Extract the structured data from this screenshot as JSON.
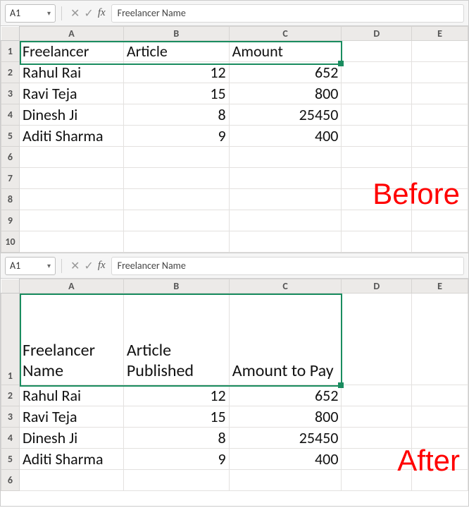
{
  "before": {
    "label": "Before",
    "name_box": "A1",
    "formula": "Freelancer Name",
    "columns": [
      "A",
      "B",
      "C",
      "D",
      "E"
    ],
    "rows": [
      "1",
      "2",
      "3",
      "4",
      "5",
      "6",
      "7",
      "8",
      "9",
      "10"
    ],
    "header": {
      "a": "Freelancer",
      "b": "Article",
      "c": "Amount"
    },
    "data": [
      {
        "name": "Rahul Rai",
        "articles": 12,
        "amount": 652
      },
      {
        "name": "Ravi Teja",
        "articles": 15,
        "amount": 800
      },
      {
        "name": "Dinesh Ji",
        "articles": 8,
        "amount": 25450
      },
      {
        "name": "Aditi Sharma",
        "articles": 9,
        "amount": 400
      }
    ]
  },
  "after": {
    "label": "After",
    "name_box": "A1",
    "formula": "Freelancer Name",
    "columns": [
      "A",
      "B",
      "C",
      "D",
      "E"
    ],
    "rows": [
      "1",
      "2",
      "3",
      "4",
      "5",
      "6"
    ],
    "header": {
      "a": "Freelancer Name",
      "b": "Article Published",
      "c": "Amount to Pay"
    },
    "data": [
      {
        "name": "Rahul Rai",
        "articles": 12,
        "amount": 652
      },
      {
        "name": "Ravi Teja",
        "articles": 15,
        "amount": 800
      },
      {
        "name": "Dinesh Ji",
        "articles": 8,
        "amount": 25450
      },
      {
        "name": "Aditi Sharma",
        "articles": 9,
        "amount": 400
      }
    ]
  },
  "chart_data": {
    "type": "table",
    "columns": [
      "Freelancer Name",
      "Article Published",
      "Amount to Pay"
    ],
    "rows": [
      [
        "Rahul Rai",
        12,
        652
      ],
      [
        "Ravi Teja",
        15,
        800
      ],
      [
        "Dinesh Ji",
        8,
        25450
      ],
      [
        "Aditi Sharma",
        9,
        400
      ]
    ]
  }
}
